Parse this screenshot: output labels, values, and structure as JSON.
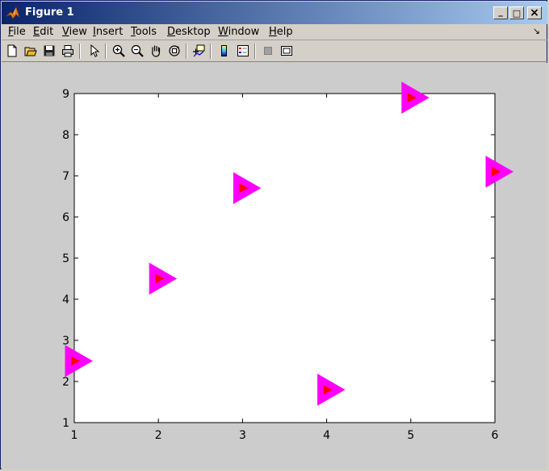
{
  "window": {
    "title": "Figure 1"
  },
  "window_controls": {
    "minimize": "_",
    "maximize": "□",
    "close": "×"
  },
  "menu": {
    "items": [
      {
        "label": "File"
      },
      {
        "label": "Edit"
      },
      {
        "label": "View"
      },
      {
        "label": "Insert"
      },
      {
        "label": "Tools"
      },
      {
        "label": "Desktop"
      },
      {
        "label": "Window"
      },
      {
        "label": "Help"
      }
    ],
    "overflow": "↘"
  },
  "toolbar": {
    "icons": [
      "new-figure-icon",
      "open-file-icon",
      "save-icon",
      "print-icon",
      "edit-plot-arrow-icon",
      "zoom-in-icon",
      "zoom-out-icon",
      "pan-hand-icon",
      "rotate-3d-icon",
      "data-cursor-icon",
      "colorbar-icon",
      "legend-icon",
      "hide-plot-tools-icon",
      "show-plot-tools-icon"
    ]
  },
  "chart_data": {
    "type": "scatter",
    "title": "",
    "xlabel": "",
    "ylabel": "",
    "xlim": [
      1,
      6
    ],
    "ylim": [
      1,
      9
    ],
    "xticks": [
      "1",
      "2",
      "3",
      "4",
      "5",
      "6"
    ],
    "yticks": [
      "1",
      "2",
      "3",
      "4",
      "5",
      "6",
      "7",
      "8",
      "9"
    ],
    "grid": false,
    "marker": {
      "shape": "triangle-right",
      "edge_color": "#ff00ff",
      "face_color": "#ff00ff",
      "inner_color": "#ff0000"
    },
    "series": [
      {
        "x": [
          1,
          2,
          3,
          4,
          5,
          6
        ],
        "y": [
          2.5,
          4.5,
          6.7,
          1.8,
          8.9,
          7.1
        ]
      }
    ]
  }
}
